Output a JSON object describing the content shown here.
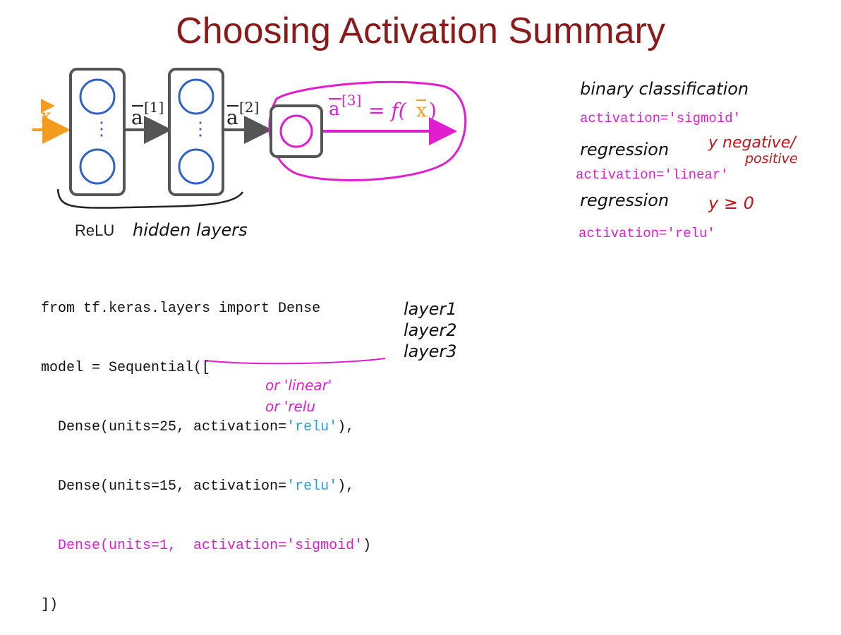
{
  "title": "Choosing Activation Summary",
  "colors": {
    "title": "#8b1a1a",
    "input_arrow": "#f39c1f",
    "neuron": "#2f62c9",
    "layer_box": "#555555",
    "output_highlight": "#e21ccf",
    "relu_string": "#2aa0d6",
    "y_note": "#c0161c"
  },
  "diagram": {
    "input_label": "x",
    "a1_label": "a",
    "a1_sup": "[1]",
    "a2_label": "a",
    "a2_sup": "[2]",
    "a3_label": "a",
    "a3_sup": "[3]",
    "output_eq": "= f(",
    "output_x": "x",
    "output_close": ")",
    "dots": "⋮",
    "brace_caption_relu": "ReLU",
    "brace_caption_hidden": "hidden layers"
  },
  "code": {
    "line1": "from tf.keras.layers import Dense",
    "line2": "model = Sequential([",
    "line3_pre": "  Dense(units=25, activation=",
    "line3_str": "'relu'",
    "line3_post": "),",
    "line4_pre": "  Dense(units=15, activation=",
    "line4_str": "'relu'",
    "line4_post": "),",
    "line5_pre": "  Dense(units=1,  ",
    "line5_str": "activation='sigmoid'",
    "line5_post": ")",
    "line6": "])"
  },
  "layer_notes": [
    "layer1",
    "layer2",
    "layer3"
  ],
  "alternatives": [
    "or 'linear'",
    "or 'relu"
  ],
  "right_notes": {
    "binary": "binary classification",
    "sigmoid": "activation='sigmoid'",
    "regression1": "regression",
    "y_neg": "y negative/",
    "positive": "positive",
    "linear": "activation='linear'",
    "regression2": "regression",
    "y_ge": "y ≥ 0",
    "relu": "activation='relu'"
  }
}
